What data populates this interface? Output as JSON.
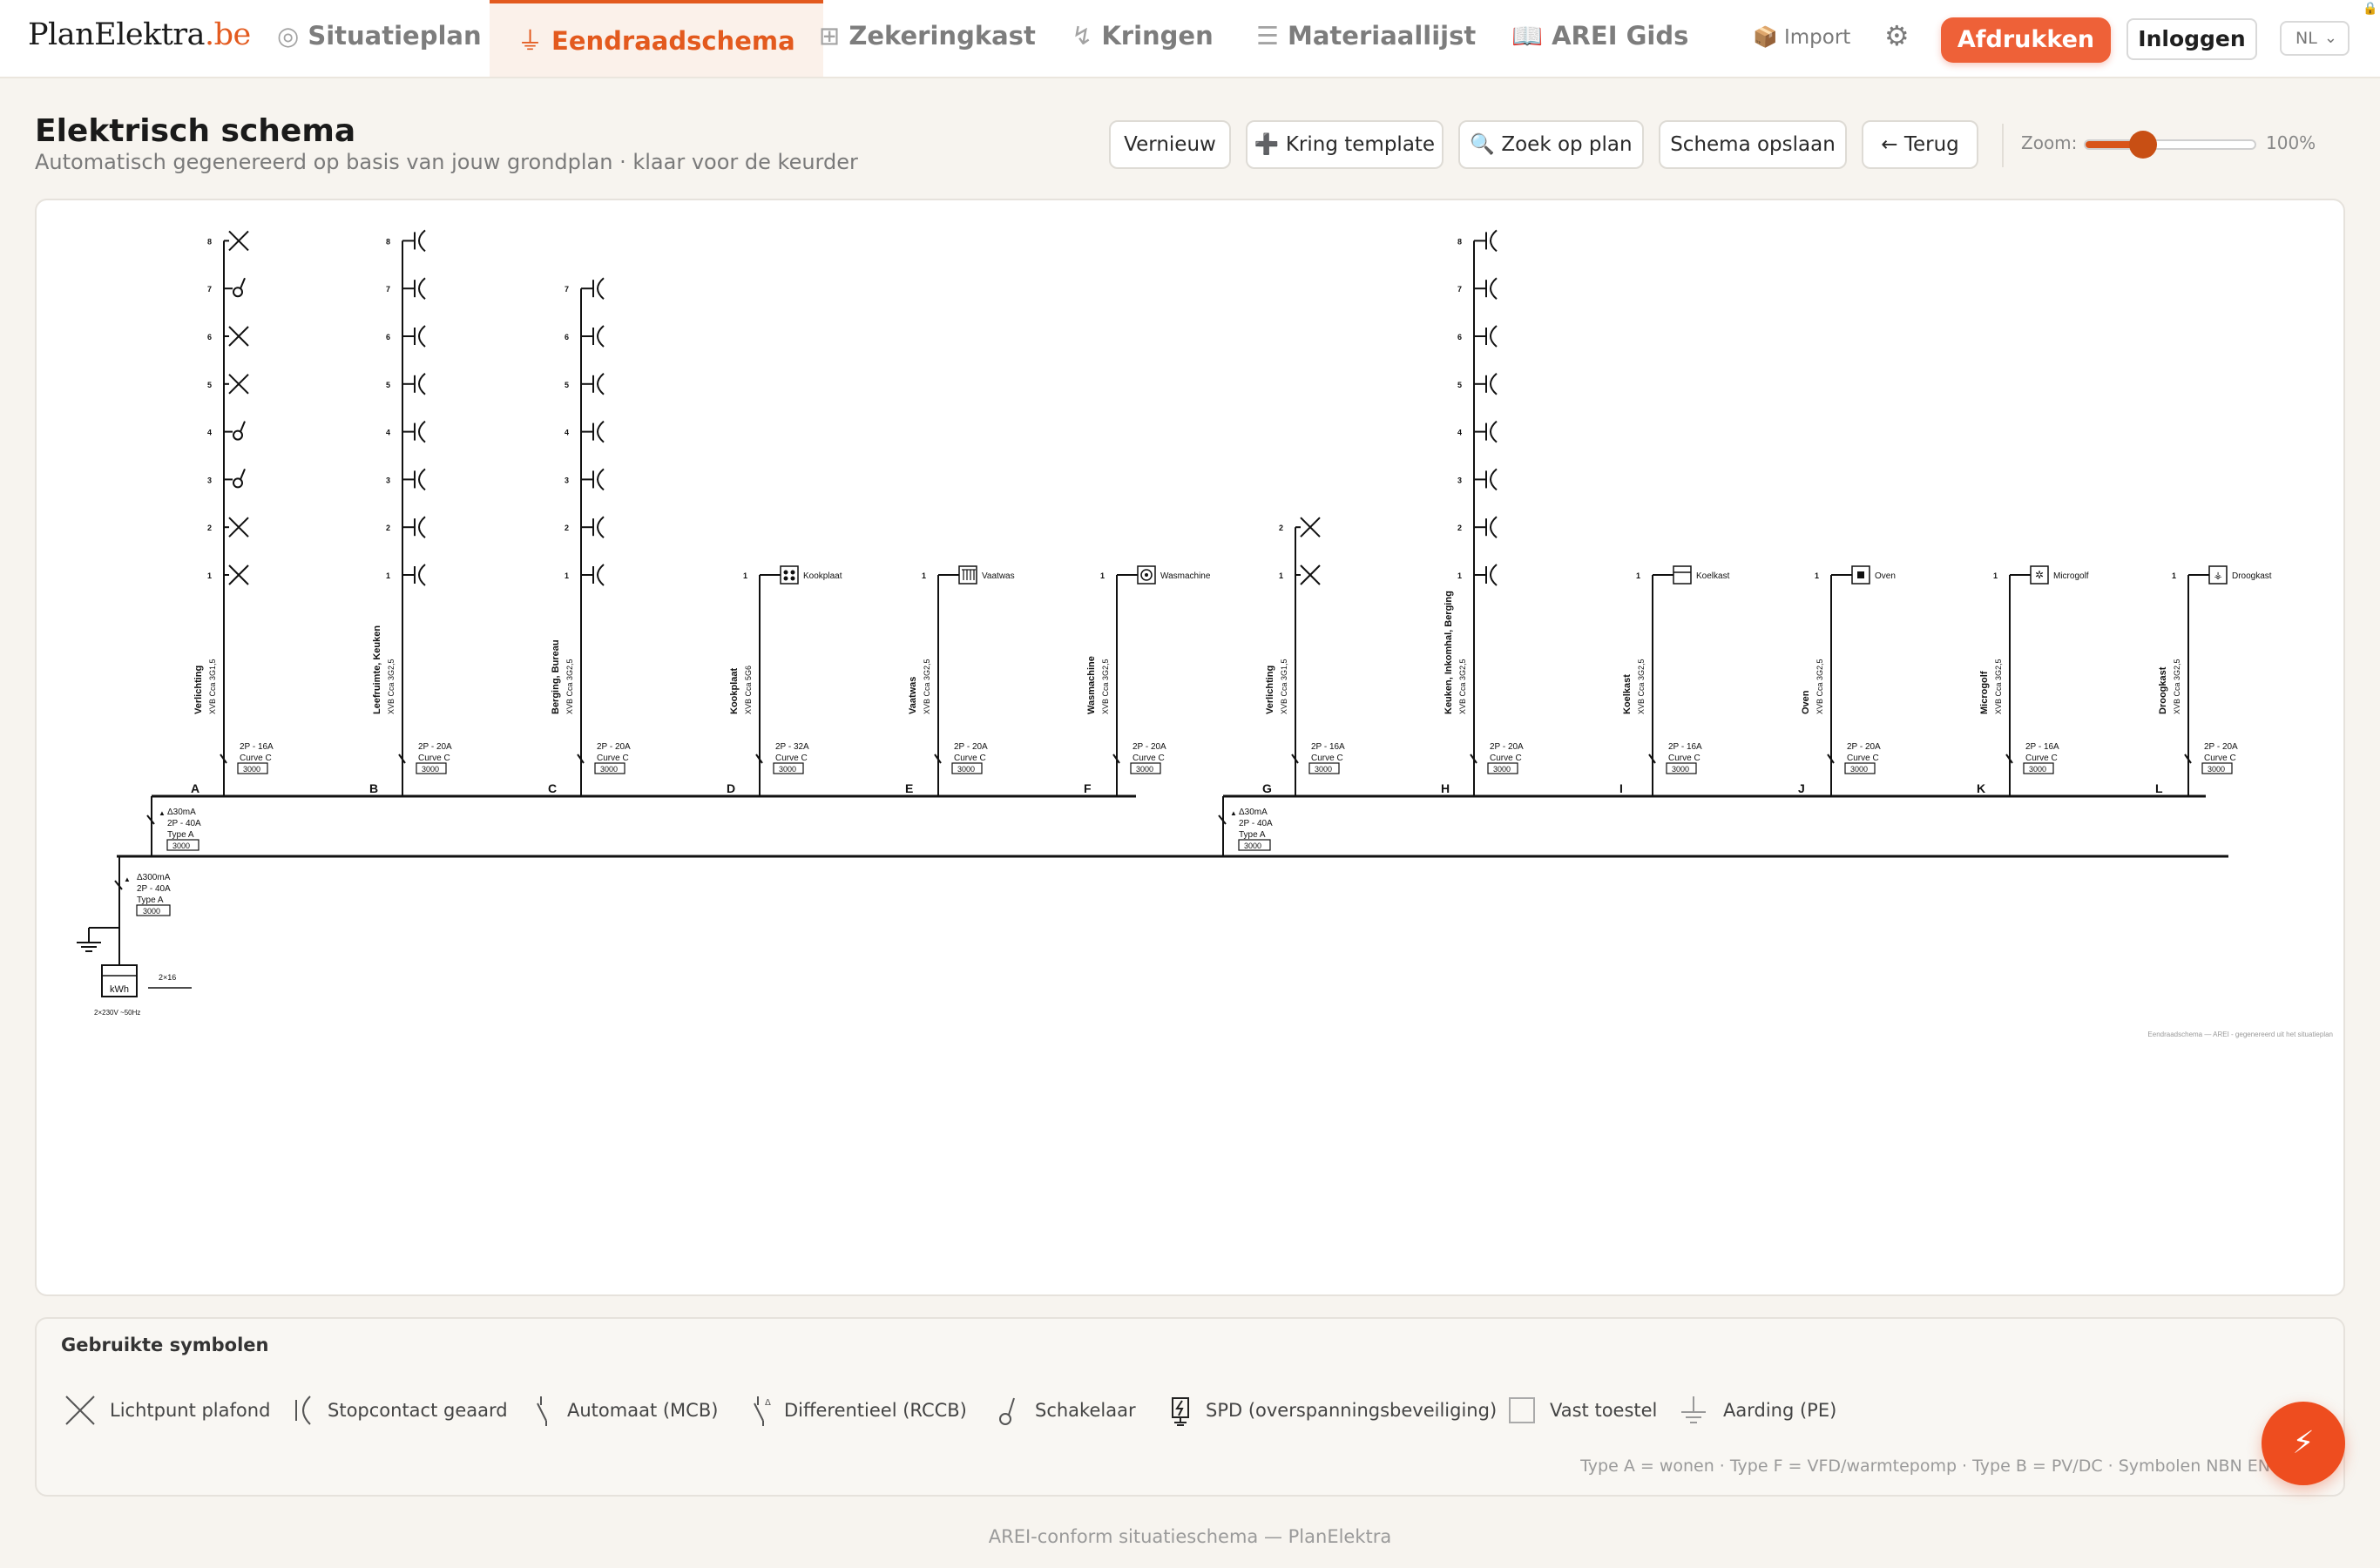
{
  "brand": {
    "name": "PlanElektra",
    "tld": ".be"
  },
  "nav": {
    "tabs": [
      {
        "icon": "◎",
        "label": "Situatieplan"
      },
      {
        "icon": "⏚",
        "label": "Eendraadschema"
      },
      {
        "icon": "⊞",
        "label": "Zekeringkast"
      },
      {
        "icon": "↯",
        "label": "Kringen"
      },
      {
        "icon": "☰",
        "label": "Materiaallijst"
      },
      {
        "icon": "📖",
        "label": "AREI Gids"
      }
    ],
    "import_label": "Import",
    "print_label": "Afdrukken",
    "login_label": "Inloggen",
    "language": "NL"
  },
  "page": {
    "title": "Elektrisch schema",
    "subtitle": "Automatisch gegenereerd op basis van jouw grondplan · klaar voor de keurder"
  },
  "toolbar": {
    "refresh_label": "Vernieuw",
    "template_label": "➕ Kring template",
    "find_label": "🔍 Zoek op plan",
    "save_label": "Schema opslaan",
    "back_label": "← Terug",
    "zoom_label": "Zoom:",
    "zoom_value": "100%",
    "zoom_level": 0.35
  },
  "schema": {
    "groups": [
      {
        "rccb": [
          "Δ30mA",
          "2P - 40A",
          "Type A",
          "3000"
        ]
      },
      {
        "rccb": [
          "Δ30mA",
          "2P - 40A",
          "Type A",
          "3000"
        ]
      }
    ],
    "main": {
      "rccb": [
        "Δ300mA",
        "2P - 40A",
        "Type A",
        "3000"
      ],
      "meter_label": "kWh",
      "supply": "2×230V ~50Hz",
      "cable": "2×16"
    },
    "circuits": [
      {
        "letter": "A",
        "name": "Verlichting",
        "cable": "XVB Cca 3G1,5",
        "mcb": [
          "2P - 16A",
          "Curve C",
          "3000"
        ],
        "points": [
          "light",
          "light",
          "switch",
          "switch",
          "light",
          "light",
          "switch",
          "light"
        ],
        "label": ""
      },
      {
        "letter": "B",
        "name": "Leefruimte, Keuken",
        "cable": "XVB Cca 3G2,5",
        "mcb": [
          "2P - 20A",
          "Curve C",
          "3000"
        ],
        "points": [
          "socket",
          "socket",
          "socket",
          "socket",
          "socket",
          "socket",
          "socket",
          "socket"
        ],
        "label": ""
      },
      {
        "letter": "C",
        "name": "Berging, Bureau",
        "cable": "XVB Cca 3G2,5",
        "mcb": [
          "2P - 20A",
          "Curve C",
          "3000"
        ],
        "points": [
          "socket",
          "socket",
          "socket",
          "socket",
          "socket",
          "socket",
          "socket"
        ],
        "label": ""
      },
      {
        "letter": "D",
        "name": "Kookplaat",
        "cable": "XVB Cca 5G6",
        "mcb": [
          "2P - 32A",
          "Curve C",
          "3000"
        ],
        "points": [
          "device-hob"
        ],
        "label": "Kookplaat"
      },
      {
        "letter": "E",
        "name": "Vaatwas",
        "cable": "XVB Cca 3G2,5",
        "mcb": [
          "2P - 20A",
          "Curve C",
          "3000"
        ],
        "points": [
          "device-dish"
        ],
        "label": "Vaatwas"
      },
      {
        "letter": "F",
        "name": "Wasmachine",
        "cable": "XVB Cca 3G2,5",
        "mcb": [
          "2P - 20A",
          "Curve C",
          "3000"
        ],
        "points": [
          "device-wash"
        ],
        "label": "Wasmachine"
      },
      {
        "letter": "G",
        "name": "Verlichting",
        "cable": "XVB Cca 3G1,5",
        "mcb": [
          "2P - 16A",
          "Curve C",
          "3000"
        ],
        "points": [
          "light",
          "light"
        ],
        "label": ""
      },
      {
        "letter": "H",
        "name": "Keuken, Inkomhal, Berging",
        "cable": "XVB Cca 3G2,5",
        "mcb": [
          "2P - 20A",
          "Curve C",
          "3000"
        ],
        "points": [
          "socket",
          "socket",
          "socket",
          "socket",
          "socket",
          "socket",
          "socket",
          "socket"
        ],
        "label": ""
      },
      {
        "letter": "I",
        "name": "Koelkast",
        "cable": "XVB Cca 3G2,5",
        "mcb": [
          "2P - 16A",
          "Curve C",
          "3000"
        ],
        "points": [
          "device-fridge"
        ],
        "label": "Koelkast"
      },
      {
        "letter": "J",
        "name": "Oven",
        "cable": "XVB Cca 3G2,5",
        "mcb": [
          "2P - 20A",
          "Curve C",
          "3000"
        ],
        "points": [
          "device-oven"
        ],
        "label": "Oven"
      },
      {
        "letter": "K",
        "name": "Microgolf",
        "cable": "XVB Cca 3G2,5",
        "mcb": [
          "2P - 16A",
          "Curve C",
          "3000"
        ],
        "points": [
          "device-micro"
        ],
        "label": "Microgolf"
      },
      {
        "letter": "L",
        "name": "Droogkast",
        "cable": "XVB Cca 3G2,5",
        "mcb": [
          "2P - 20A",
          "Curve C",
          "3000"
        ],
        "points": [
          "device-dryer"
        ],
        "label": "Droogkast"
      }
    ],
    "footer_note": "Eendraadschema — AREI - gegenereerd uit het situatieplan"
  },
  "legend": {
    "title": "Gebruikte symbolen",
    "items": [
      {
        "icon": "light-icon",
        "label": "Lichtpunt plafond"
      },
      {
        "icon": "socket-icon",
        "label": "Stopcontact geaard"
      },
      {
        "icon": "mcb-icon",
        "label": "Automaat (MCB)"
      },
      {
        "icon": "rccb-icon",
        "label": "Differentieel (RCCB)"
      },
      {
        "icon": "switch-icon",
        "label": "Schakelaar"
      },
      {
        "icon": "spd-icon",
        "label": "SPD (overspanningsbeveiliging)"
      },
      {
        "icon": "device-icon",
        "label": "Vast toestel"
      },
      {
        "icon": "earth-icon",
        "label": "Aarding (PE)"
      }
    ],
    "note": "Type A = wonen · Type F = VFD/warmtepomp · Type B = PV/DC · Symbolen NBN EN"
  },
  "fab_icon": "⚡",
  "footer": "AREI-conform situatieschema — PlanElektra",
  "colors": {
    "accent": "#e35a1e",
    "print_button": "#ee6138",
    "fab": "#ee4d1f"
  }
}
